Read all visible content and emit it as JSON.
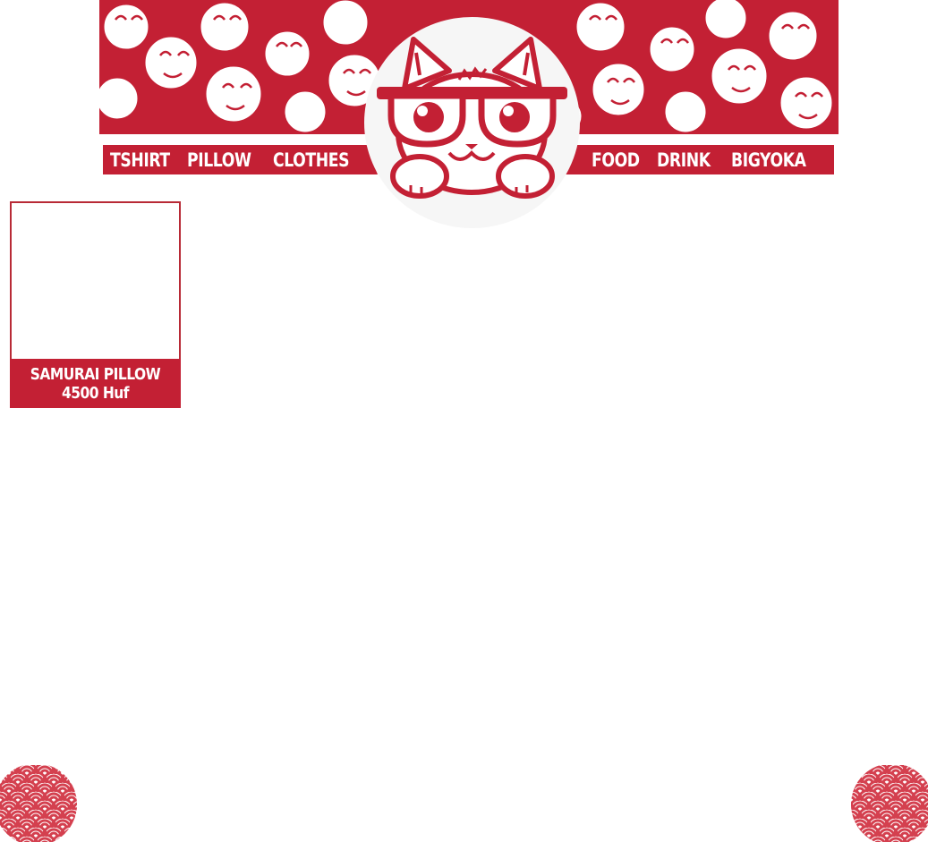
{
  "nav": {
    "left": [
      "TSHIRT",
      "PILLOW",
      "CLOTHES"
    ],
    "right": [
      "FOOD",
      "DRINK",
      "BIGYOKA"
    ]
  },
  "product": {
    "title": "SAMURAI PILLOW",
    "price": "4500 Huf"
  },
  "colors": {
    "brand_red": "#c32034",
    "background": "#ffffff",
    "logo_disc": "#f6f6f6"
  },
  "icons": {
    "logo": "cat-with-glasses-logo",
    "banner": "cat-doodle-pattern",
    "corners": "seigaiha-wave-pattern"
  }
}
